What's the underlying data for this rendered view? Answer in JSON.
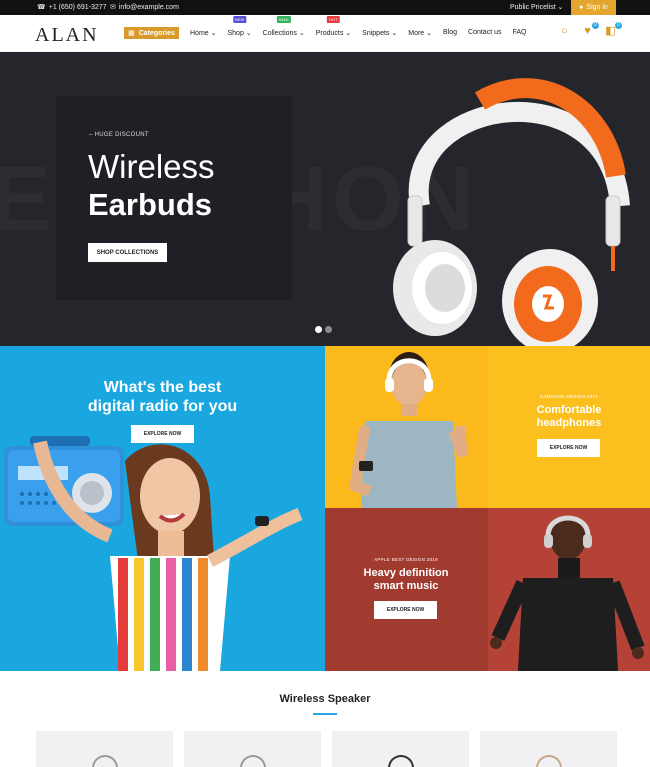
{
  "topbar": {
    "phone": "+1 (650) 691-3277",
    "email": "info@example.com",
    "pricelist": "Public Pricelist",
    "signin": "Sign in"
  },
  "nav": {
    "logo": "ALAN",
    "categories": "Categories",
    "menu": [
      {
        "label": "Home",
        "dropdown": true,
        "badge": ""
      },
      {
        "label": "Shop",
        "dropdown": true,
        "badge": "NEW",
        "badge_color": "#5b4fd6"
      },
      {
        "label": "Collections",
        "dropdown": true,
        "badge": "SALE",
        "badge_color": "#35b35b"
      },
      {
        "label": "Products",
        "dropdown": true,
        "badge": "HOT",
        "badge_color": "#e53d3d"
      },
      {
        "label": "Snippets",
        "dropdown": true,
        "badge": ""
      },
      {
        "label": "More",
        "dropdown": true,
        "badge": ""
      },
      {
        "label": "Blog",
        "dropdown": false,
        "badge": ""
      },
      {
        "label": "Contact us",
        "dropdown": false,
        "badge": ""
      },
      {
        "label": "FAQ",
        "dropdown": false,
        "badge": ""
      }
    ],
    "wishlist_count": "0",
    "cart_count": "0"
  },
  "hero": {
    "background_word": "EADPHON",
    "eyebrow": "– HUGE DISCOUNT",
    "title_line1": "Wireless",
    "title_line2": "Earbuds",
    "button": "SHOP COLLECTIONS",
    "slides": 2,
    "active_slide": 1
  },
  "promo_left": {
    "title_line1": "What's the best",
    "title_line2": "digital radio for you",
    "button": "EXPLORE NOW"
  },
  "promo_top_right": {
    "eyebrow": "SAMSUNG DESIGN 2019",
    "title_line1": "Comfortable",
    "title_line2": "headphones",
    "button": "EXPLORE NOW"
  },
  "promo_bottom_right": {
    "eyebrow": "APPLE BEST DESIGN 2019",
    "title_line1": "Heavy definition",
    "title_line2": "smart music",
    "button": "EXPLORE NOW"
  },
  "section": {
    "title": "Wireless Speaker"
  },
  "colors": {
    "accent": "#d99a2b",
    "blue": "#1aa7e0",
    "yellow": "#fbb91c",
    "red": "#a23b2f",
    "hero_bg": "#25252c"
  }
}
